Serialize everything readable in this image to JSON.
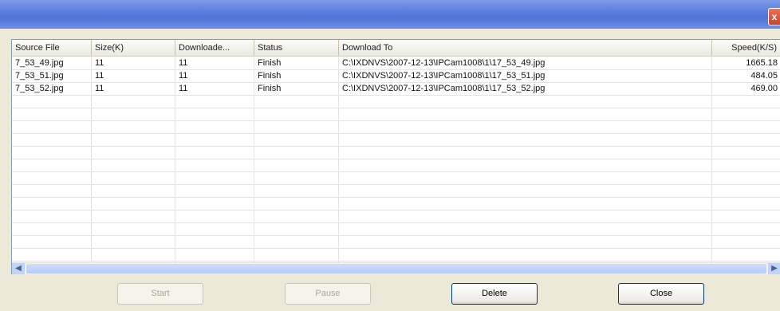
{
  "window": {
    "close_glyph": "x",
    "colors": {
      "titlebar": "#5a7fdc",
      "close": "#c8452b"
    }
  },
  "table": {
    "columns": [
      "Source File",
      "Size(K)",
      "Downloade...",
      "Status",
      "Download To",
      "Speed(K/S)"
    ],
    "rows": [
      {
        "source_file": "7_53_49.jpg",
        "size": "11",
        "downloaded": "11",
        "status": "Finish",
        "download_to": "C:\\IXDNVS\\2007-12-13\\IPCam1008\\1\\17_53_49.jpg",
        "speed": "1665.18"
      },
      {
        "source_file": "7_53_51.jpg",
        "size": "11",
        "downloaded": "11",
        "status": "Finish",
        "download_to": "C:\\IXDNVS\\2007-12-13\\IPCam1008\\1\\17_53_51.jpg",
        "speed": "484.05"
      },
      {
        "source_file": "7_53_52.jpg",
        "size": "11",
        "downloaded": "11",
        "status": "Finish",
        "download_to": "C:\\IXDNVS\\2007-12-13\\IPCam1008\\1\\17_53_52.jpg",
        "speed": "469.00"
      }
    ]
  },
  "scrollbar": {
    "left_icon": "scroll-left-icon",
    "right_icon": "scroll-right-icon",
    "left_glyph": "◀",
    "right_glyph": "▶"
  },
  "buttons": {
    "start": "Start",
    "pause": "Pause",
    "delete": "Delete",
    "close": "Close"
  }
}
